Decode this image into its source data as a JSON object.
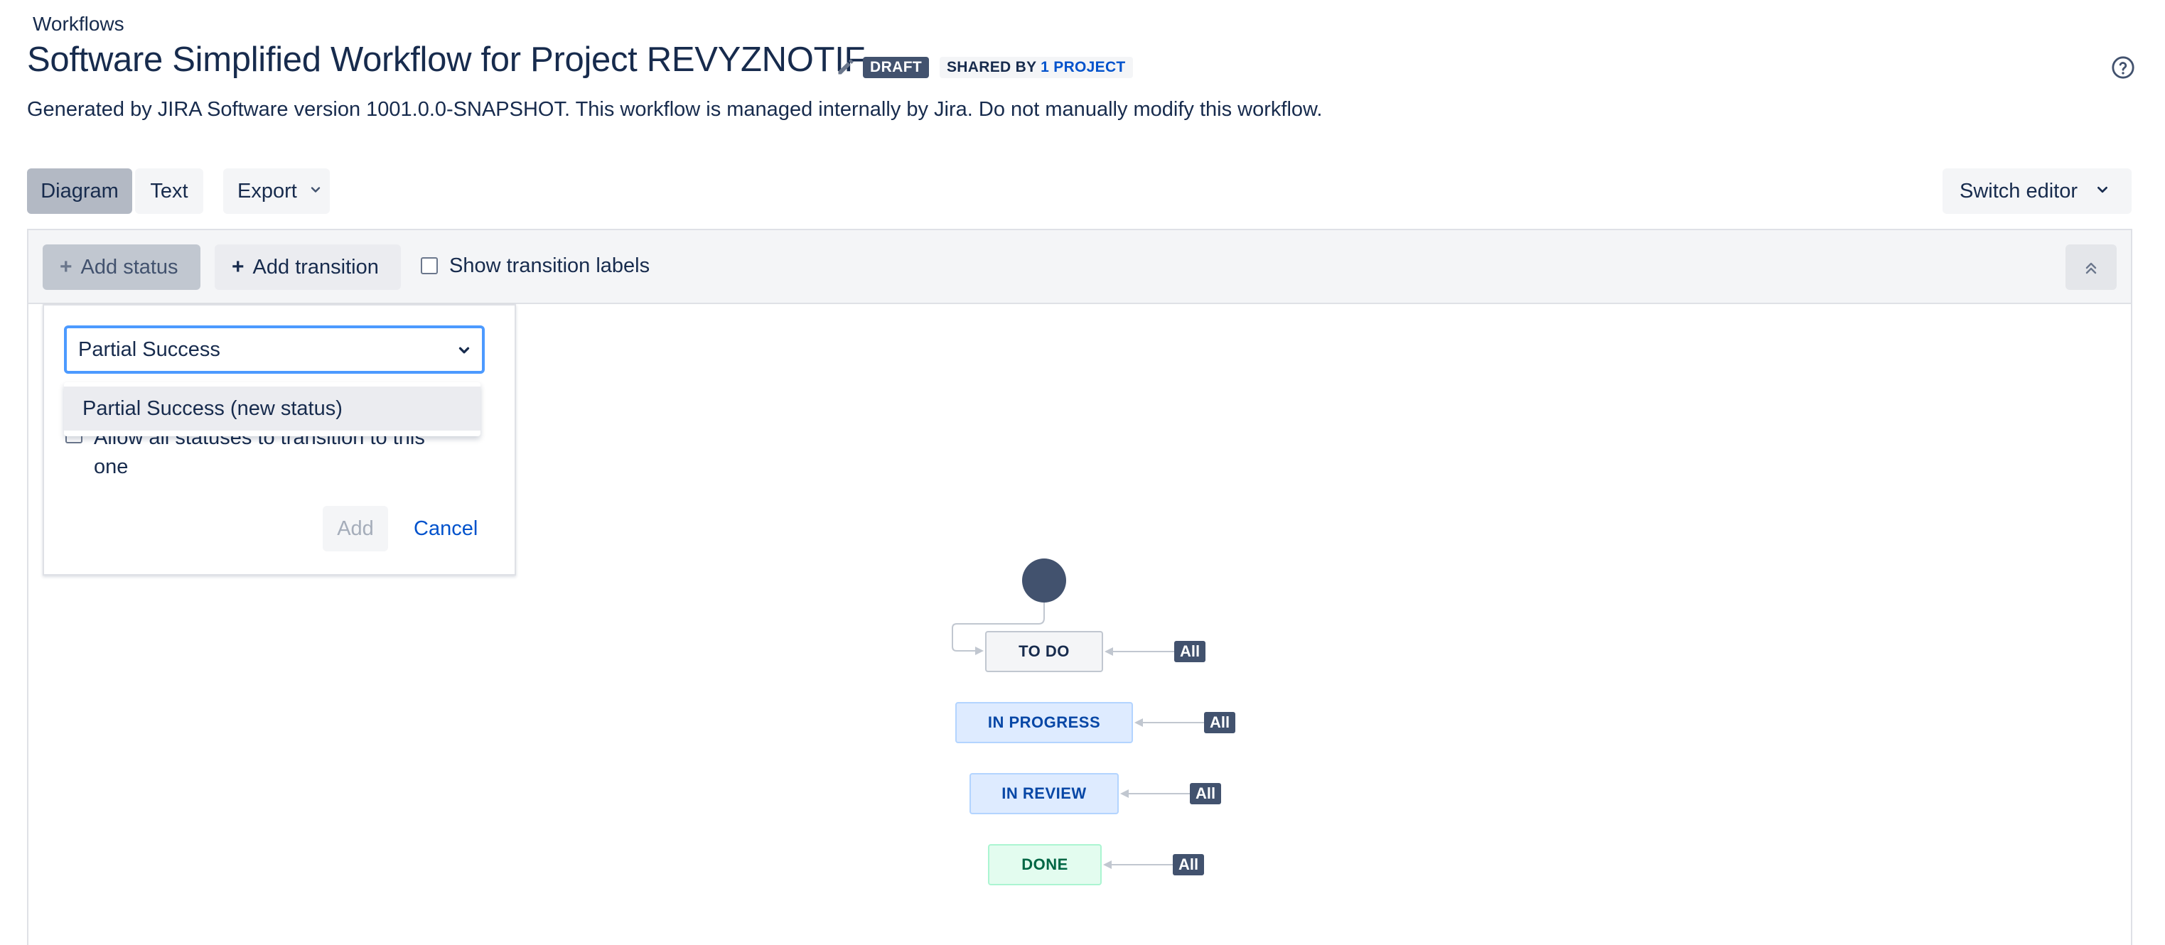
{
  "header": {
    "breadcrumb": "Workflows",
    "title": "Software Simplified Workflow for Project REVYZNOTIF",
    "draft_badge": "DRAFT",
    "shared_by_prefix": "SHARED BY",
    "shared_by_link": "1 PROJECT",
    "description": "Generated by JIRA Software version 1001.0.0-SNAPSHOT. This workflow is managed internally by Jira. Do not manually modify this workflow."
  },
  "view_tabs": [
    {
      "label": "Diagram",
      "selected": true
    },
    {
      "label": "Text",
      "selected": false
    }
  ],
  "export_label": "Export",
  "switch_editor_label": "Switch editor",
  "toolbar": {
    "add_status": "Add status",
    "add_transition": "Add transition",
    "show_transition_labels": "Show transition labels",
    "show_transition_labels_checked": false
  },
  "add_status_dialog": {
    "select_value": "Partial Success",
    "dropdown_option": "Partial Success (new status)",
    "allow_all_label": "Allow all statuses to transition to this one",
    "allow_all_checked": false,
    "add_button": "Add",
    "cancel_button": "Cancel"
  },
  "diagram": {
    "statuses": [
      {
        "label": "TO DO",
        "category": "todo"
      },
      {
        "label": "IN PROGRESS",
        "category": "in-progress"
      },
      {
        "label": "IN REVIEW",
        "category": "in-progress"
      },
      {
        "label": "DONE",
        "category": "done"
      }
    ],
    "global_transition_label": "All"
  },
  "icons": [
    "pencil-icon",
    "help-icon",
    "chevron-down-icon",
    "plus-icon",
    "double-chevron-up-icon",
    "start-node-icon"
  ],
  "colors": {
    "primary_text": "#172b4d",
    "link": "#0052cc",
    "focus_border": "#4c9aff",
    "badge_dark": "#42526e",
    "todo_bg": "#f4f5f7",
    "in_progress_bg": "#deebff",
    "done_bg": "#e3fcef"
  }
}
